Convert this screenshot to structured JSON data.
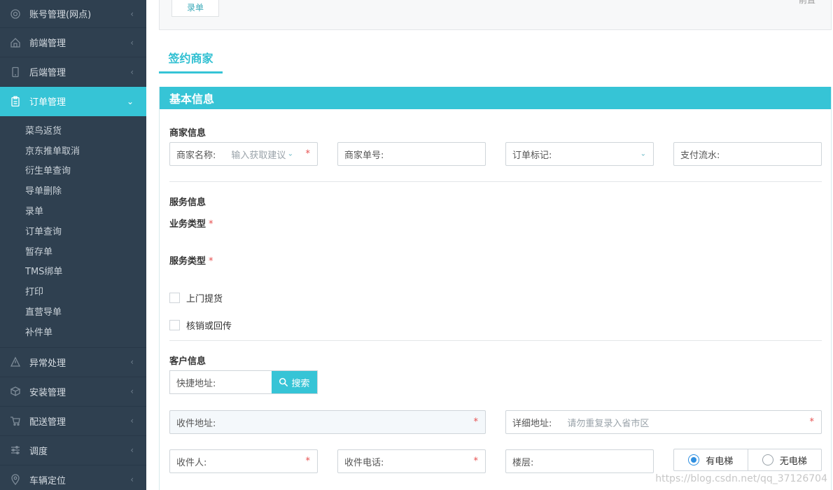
{
  "sidebar": {
    "items": [
      {
        "label": "账号管理(网点)",
        "icon": "gear-icon"
      },
      {
        "label": "前端管理",
        "icon": "home-icon"
      },
      {
        "label": "后端管理",
        "icon": "mobile-icon"
      },
      {
        "label": "订单管理",
        "icon": "clipboard-icon"
      },
      {
        "label": "异常处理",
        "icon": "alert-icon"
      },
      {
        "label": "安装管理",
        "icon": "box-icon"
      },
      {
        "label": "配送管理",
        "icon": "cart-icon"
      },
      {
        "label": "调度",
        "icon": "sliders-icon"
      },
      {
        "label": "车辆定位",
        "icon": "pin-icon"
      }
    ],
    "submenu": [
      "菜鸟返货",
      "京东推单取消",
      "衍生单查询",
      "导单删除",
      "录单",
      "订单查询",
      "暂存单",
      "TMS绑单",
      "打印",
      "直营导单",
      "补件单"
    ]
  },
  "topbox": {
    "tab_label": "录单",
    "corner_text": "前置"
  },
  "page_tab": "签约商家",
  "panel": {
    "title": "基本信息",
    "merchant": {
      "title": "商家信息",
      "name_label": "商家名称:",
      "name_placeholder": "输入获取建议",
      "order_no_label": "商家单号:",
      "mark_label": "订单标记:",
      "pay_label": "支付流水:"
    },
    "service": {
      "title": "服务信息",
      "biz_type_label": "业务类型",
      "service_type_label": "服务类型",
      "pickup_label": "上门提货",
      "verify_label": "核销或回传"
    },
    "customer": {
      "title": "客户信息",
      "quick_addr_label": "快捷地址:",
      "search_label": "搜索",
      "recv_addr_label": "收件地址:",
      "detail_addr_label": "详细地址:",
      "detail_addr_placeholder": "请勿重复录入省市区",
      "receiver_label": "收件人:",
      "phone_label": "收件电话:",
      "floor_label": "楼层:",
      "elevator_yes": "有电梯",
      "elevator_no": "无电梯"
    }
  },
  "watermark": "https://blog.csdn.net/qq_37126704",
  "colors": {
    "accent": "#36c4d6",
    "sidebar": "#2f4050",
    "required": "#e64c4c"
  }
}
